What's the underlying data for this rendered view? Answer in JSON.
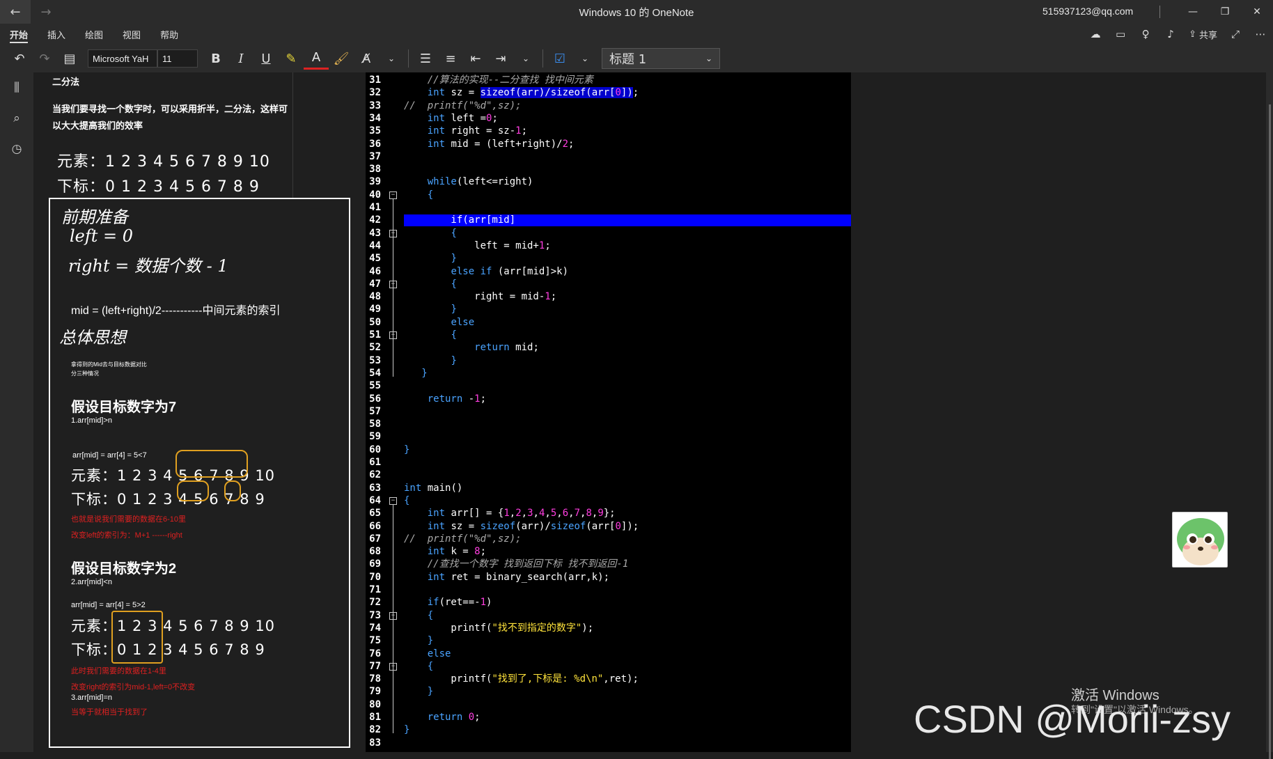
{
  "titlebar": {
    "title": "Windows 10 的 OneNote",
    "user": "515937123@qq.com"
  },
  "menu": {
    "items": [
      "开始",
      "插入",
      "绘图",
      "视图",
      "帮助"
    ],
    "active": 0,
    "share": "共享"
  },
  "ribbon": {
    "font_name": "Microsoft YaH",
    "font_size": "11",
    "style": "标题 1"
  },
  "notes": {
    "heading": "二分法",
    "intro": "当我们要寻找一个数字时，可以采用折半，二分法，这样可以大大提高我们的效率",
    "elements_line": "元素：1 2 3 4 5 6 7 8 9 10",
    "index_line": "下标：0 1 2 3 4 5 6 7 8 9",
    "hw_prep": "前期准备",
    "hw_left": "left = 0",
    "hw_right": "right = 数据个数 - 1",
    "mid_formula": "mid = (left+right)/2-----------中间元素的索引",
    "hw_idea": "总体思想",
    "tiny1": "拿得到的Mid去与目标数据对比",
    "tiny2": "分三种情况",
    "case7_title": "假设目标数字为7",
    "case7_sub": "1.arr[mid]>n",
    "case7_eq": "arr[mid] = arr[4] = 5<7",
    "case7_el": "元素：1 2 3 4 5 6 7 8 9 10",
    "case7_ix": "下标：0 1 2 3 4 5 6 7 8 9",
    "case7_red1": "也就是说我们需要的数据在6-10里",
    "case7_red2": "改变left的索引为：M+1 ------right",
    "case2_title": "假设目标数字为2",
    "case2_sub": "2.arr[mid]<n",
    "case2_eq": "arr[mid] = arr[4] = 5>2",
    "case2_el": "元素：1 2 3 4 5 6 7 8 9 10",
    "case2_ix": "下标：0 1 2 3 4 5 6 7 8 9",
    "case2_red1": "此时我们需要的数据在1-4里",
    "case2_red2": "改变right的索引为mid-1,left=0不改变",
    "case3_sub": "3.arr[mid]=n",
    "case3_red": "当等于就相当于找到了"
  },
  "code": {
    "lines": [
      {
        "n": "31",
        "t": "    <span class='cm'>//算法的实现--二分查找 找中间元素</span>"
      },
      {
        "n": "32",
        "t": "    <span class='kw'>int</span> sz = <span class='sel'>sizeof(arr)/sizeof(arr[<span class='num'>0</span>])</span>;"
      },
      {
        "n": "33",
        "t": "<span class='cm'>//  printf(\"%d\",sz);</span>"
      },
      {
        "n": "34",
        "t": "    <span class='kw'>int</span> left =<span class='num'>0</span>;"
      },
      {
        "n": "35",
        "t": "    <span class='kw'>int</span> right = sz-<span class='num'>1</span>;"
      },
      {
        "n": "36",
        "t": "    <span class='kw'>int</span> mid = (left+right)/<span class='num'>2</span>;"
      },
      {
        "n": "37",
        "t": ""
      },
      {
        "n": "38",
        "t": ""
      },
      {
        "n": "39",
        "t": "    <span class='kw'>while</span>(left<=right)"
      },
      {
        "n": "40",
        "t": "    <span class='kw'>{</span>"
      },
      {
        "n": "41",
        "t": ""
      },
      {
        "n": "42",
        "t": "        if(arr[mid]<k)"
      },
      {
        "n": "43",
        "t": "        <span class='kw'>{</span>"
      },
      {
        "n": "44",
        "t": "            left = mid+<span class='num'>1</span>;"
      },
      {
        "n": "45",
        "t": "        <span class='kw'>}</span>"
      },
      {
        "n": "46",
        "t": "        <span class='kw'>else if</span> (arr[mid]>k)"
      },
      {
        "n": "47",
        "t": "        <span class='kw'>{</span>"
      },
      {
        "n": "48",
        "t": "            right = mid-<span class='num'>1</span>;"
      },
      {
        "n": "49",
        "t": "        <span class='kw'>}</span>"
      },
      {
        "n": "50",
        "t": "        <span class='kw'>else</span>"
      },
      {
        "n": "51",
        "t": "        <span class='kw'>{</span>"
      },
      {
        "n": "52",
        "t": "            <span class='kw'>return</span> mid;"
      },
      {
        "n": "53",
        "t": "        <span class='kw'>}</span>"
      },
      {
        "n": "54",
        "t": "   <span class='kw'>}</span>"
      },
      {
        "n": "55",
        "t": ""
      },
      {
        "n": "56",
        "t": "    <span class='kw'>return</span> -<span class='num'>1</span>;"
      },
      {
        "n": "57",
        "t": ""
      },
      {
        "n": "58",
        "t": ""
      },
      {
        "n": "59",
        "t": ""
      },
      {
        "n": "60",
        "t": "<span class='kw'>}</span>"
      },
      {
        "n": "61",
        "t": ""
      },
      {
        "n": "62",
        "t": ""
      },
      {
        "n": "63",
        "t": "<span class='kw'>int</span> main()"
      },
      {
        "n": "64",
        "t": "<span class='kw'>{</span>"
      },
      {
        "n": "65",
        "t": "    <span class='kw'>int</span> arr[] = {<span class='num'>1</span>,<span class='num'>2</span>,<span class='num'>3</span>,<span class='num'>4</span>,<span class='num'>5</span>,<span class='num'>6</span>,<span class='num'>7</span>,<span class='num'>8</span>,<span class='num'>9</span>};"
      },
      {
        "n": "66",
        "t": "    <span class='kw'>int</span> sz = <span class='kw'>sizeof</span>(arr)/<span class='kw'>sizeof</span>(arr[<span class='num'>0</span>]);"
      },
      {
        "n": "67",
        "t": "<span class='cm'>//  printf(\"%d\",sz);</span>"
      },
      {
        "n": "68",
        "t": "    <span class='kw'>int</span> k = <span class='num'>8</span>;"
      },
      {
        "n": "69",
        "t": "    <span class='cm'>//查找一个数字 找到返回下标 找不到返回-1</span>"
      },
      {
        "n": "70",
        "t": "    <span class='kw'>int</span> ret = binary_search(arr,k);"
      },
      {
        "n": "71",
        "t": ""
      },
      {
        "n": "72",
        "t": "    <span class='kw'>if</span>(ret==-<span class='num'>1</span>)"
      },
      {
        "n": "73",
        "t": "    <span class='kw'>{</span>"
      },
      {
        "n": "74",
        "t": "        printf(<span class='str'>\"找不到指定的数字\"</span>);"
      },
      {
        "n": "75",
        "t": "    <span class='kw'>}</span>"
      },
      {
        "n": "76",
        "t": "    <span class='kw'>else</span>"
      },
      {
        "n": "77",
        "t": "    <span class='kw'>{</span>"
      },
      {
        "n": "78",
        "t": "        printf(<span class='str'>\"找到了,下标是: %d\\n\"</span>,ret);"
      },
      {
        "n": "79",
        "t": "    <span class='kw'>}</span>"
      },
      {
        "n": "80",
        "t": ""
      },
      {
        "n": "81",
        "t": "    <span class='kw'>return</span> <span class='num'>0</span>;"
      },
      {
        "n": "82",
        "t": "<span class='kw'>}</span>"
      },
      {
        "n": "83",
        "t": ""
      }
    ],
    "highlight_line": "42",
    "fold_lines": [
      "40",
      "43",
      "47",
      "51",
      "64",
      "73",
      "77"
    ]
  },
  "watermarks": {
    "activate1": "激活 Windows",
    "activate2": "转到\"设置\"以激活 Windows。",
    "csdn": "CSDN @Morii-zsy"
  },
  "colors": {
    "highlight": "#0000ff",
    "keyword": "#4aa3ff",
    "number": "#ff3ee0",
    "string": "#ffe33b",
    "red_note": "#e02020"
  }
}
